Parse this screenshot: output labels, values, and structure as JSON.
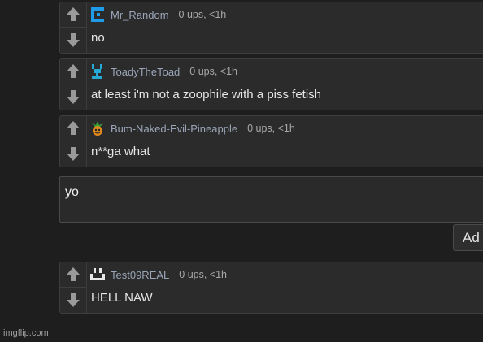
{
  "comments": [
    {
      "username": "Mr_Random",
      "meta": "0 ups, <1h",
      "text": "no",
      "avatar_icon": "blue-bracket-icon",
      "avatar_color": "#1e9be9"
    },
    {
      "username": "ToadyTheToad",
      "meta": "0 ups, <1h",
      "text": "at least i'm not a zoophile with a piss fetish",
      "avatar_icon": "pixel-creature-icon",
      "avatar_color": "#27a9d8"
    },
    {
      "username": "Bum-Naked-Evil-Pineapple",
      "meta": "0 ups, <1h",
      "text": "n**ga what",
      "avatar_icon": "pineapple-icon",
      "avatar_color": "#e08a1e"
    },
    {
      "username": "Test09REAL",
      "meta": "0 ups, <1h",
      "text": "HELL NAW",
      "avatar_icon": "pixel-face-icon",
      "avatar_color": "#e8e8e8"
    }
  ],
  "reply": {
    "value": "yo",
    "button_label": "Ad"
  },
  "watermark": "imgflip.com"
}
